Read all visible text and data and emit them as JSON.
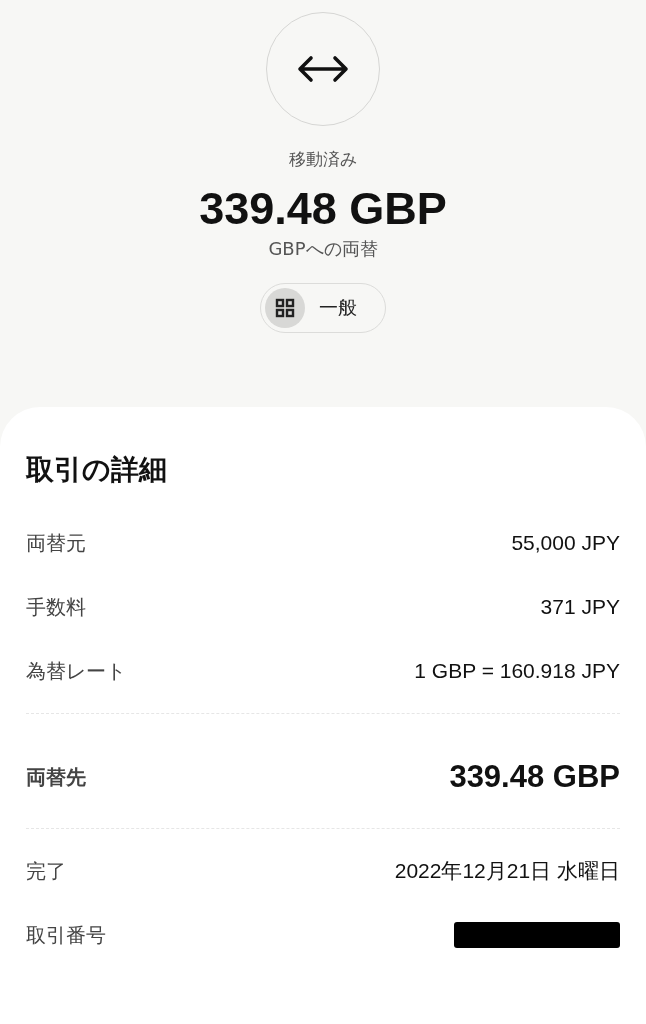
{
  "header": {
    "status": "移動済み",
    "amount": "339.48 GBP",
    "description": "GBPへの両替",
    "category": {
      "label": "一般"
    }
  },
  "details": {
    "title": "取引の詳細",
    "groups": [
      [
        {
          "kind": "normal",
          "label": "両替元",
          "value": "55,000 JPY"
        },
        {
          "kind": "normal",
          "label": "手数料",
          "value": "371 JPY"
        },
        {
          "kind": "normal",
          "label": "為替レート",
          "value": "1 GBP = 160.918 JPY"
        }
      ],
      [
        {
          "kind": "amount",
          "label": "両替先",
          "value": "339.48 GBP"
        }
      ],
      [
        {
          "kind": "normal",
          "label": "完了",
          "value": "2022年12月21日 水曜日"
        },
        {
          "kind": "redacted",
          "label": "取引番号"
        }
      ]
    ]
  }
}
